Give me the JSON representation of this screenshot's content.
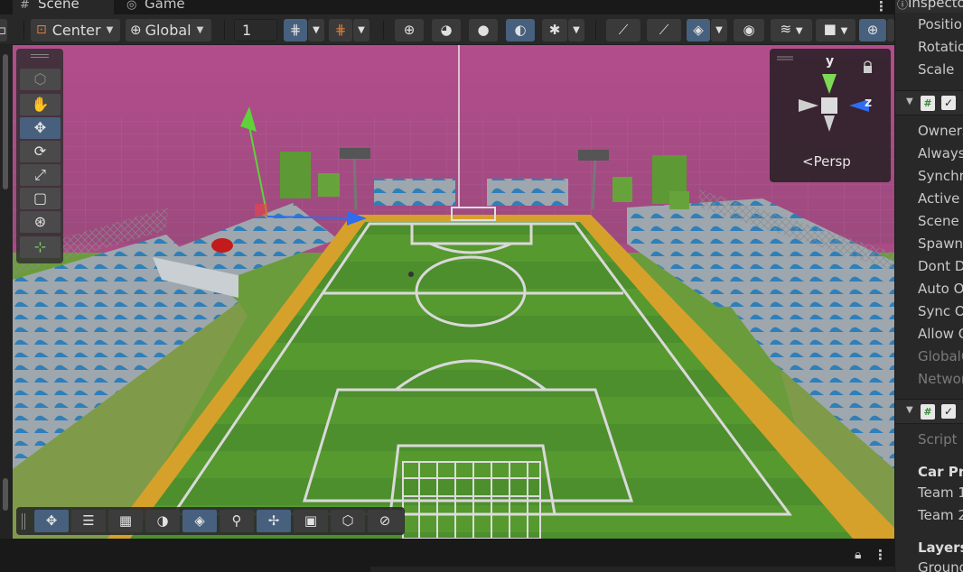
{
  "tabs": [
    {
      "label": "Scene",
      "icon": "grid-icon",
      "active": true
    },
    {
      "label": "Game",
      "icon": "gamepad-icon",
      "active": false
    }
  ],
  "toolbar": {
    "pivot_mode": "Center",
    "pivot_space": "Global",
    "grid_size": "1"
  },
  "gizmo": {
    "projection_label": "Persp",
    "axis_y": "y",
    "axis_z": "z"
  },
  "inspector": {
    "title": "Inspector",
    "transform_rows": [
      "Position",
      "Rotation",
      "Scale"
    ],
    "network_object_rows": [
      "Ownership",
      "Always Replicate",
      "Synchronize",
      "Active Scene",
      "Scene Migration",
      "Spawn With Observers",
      "Dont Destroy",
      "Auto Object Parent",
      "Sync Owner Transform",
      "Allow Owner"
    ],
    "network_object_dim_rows": [
      "GlobalObjectIdHash",
      "NetworkObjectId"
    ],
    "script_label": "Script",
    "car_section": "Car Prefabs",
    "car_rows": [
      "Team 1",
      "Team 2"
    ],
    "layers_section": "Layers",
    "layers_rows": [
      "Ground"
    ]
  },
  "colors": {
    "sky": "#aa4b86",
    "field_green": "#4b8a2c",
    "track_orange": "#d6a12a",
    "selection_blue": "#46607e"
  }
}
